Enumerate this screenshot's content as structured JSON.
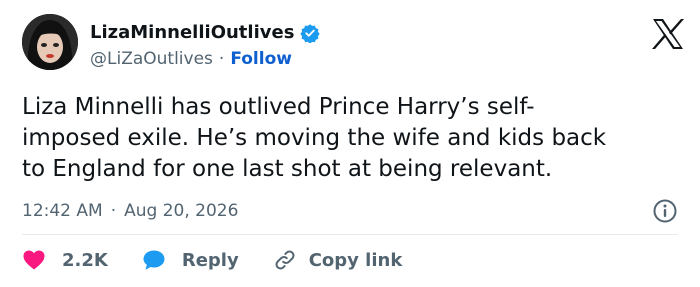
{
  "author": {
    "display_name": "LizaMinnelliOutlives",
    "handle": "@LiZaOutlives",
    "separator": "·",
    "follow_label": "Follow",
    "verified_color": "#1d9bf0"
  },
  "tweet": {
    "text": "Liza Minnelli has outlived Prince Harry’s self-\nimposed exile. He’s moving the wife and kids back\nto England for one last shot at being relevant.",
    "time": "12:42 AM",
    "separator": "·",
    "date": "Aug 20, 2026"
  },
  "actions": {
    "like_count": "2.2K",
    "like_color": "#f91880",
    "reply_label": "Reply",
    "reply_color": "#1d9bf0",
    "copy_label": "Copy link"
  },
  "icons": {
    "brand": "x-logo-icon",
    "info": "info-icon",
    "like": "heart-icon",
    "reply": "speech-bubble-icon",
    "copy": "link-icon"
  }
}
